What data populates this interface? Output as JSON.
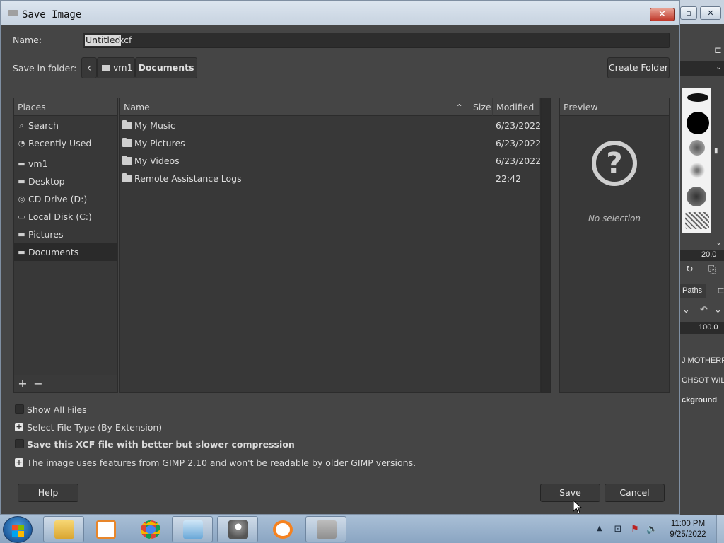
{
  "dialog": {
    "title": "Save Image",
    "close_label": "✕",
    "name_label": "Name:",
    "name_selected": "Untitled",
    "name_rest": ".xcf",
    "folder_label": "Save in folder:",
    "path": [
      "vm1",
      "Documents"
    ],
    "create_folder": "Create Folder"
  },
  "places": {
    "header": "Places",
    "items": [
      "Search",
      "Recently Used",
      "vm1",
      "Desktop",
      "CD Drive (D:)",
      "Local Disk (C:)",
      "Pictures",
      "Documents"
    ],
    "selected": "Documents",
    "add_label": "+",
    "remove_label": "−"
  },
  "files": {
    "columns": {
      "name": "Name",
      "size": "Size",
      "modified": "Modified"
    },
    "rows": [
      {
        "name": "My Music",
        "size": "",
        "modified": "6/23/2022"
      },
      {
        "name": "My Pictures",
        "size": "",
        "modified": "6/23/2022"
      },
      {
        "name": "My Videos",
        "size": "",
        "modified": "6/23/2022"
      },
      {
        "name": "Remote Assistance Logs",
        "size": "",
        "modified": "22:42"
      }
    ]
  },
  "preview": {
    "header": "Preview",
    "empty_text": "No selection"
  },
  "options": {
    "show_all_files": "Show All Files",
    "select_file_type": "Select File Type (By Extension)",
    "compression": "Save this XCF file with better but slower compression",
    "compat_note": "The image uses features from GIMP 2.10 and won't be readable by older GIMP versions."
  },
  "buttons": {
    "help": "Help",
    "save": "Save",
    "cancel": "Cancel"
  },
  "background_app": {
    "value1": "20.0",
    "tab_paths": "Paths",
    "value2": "100.0",
    "layer1": "J MOTHERFU",
    "layer2": "GHSOT WIL",
    "layer3": "ckground"
  },
  "taskbar": {
    "time": "11:00 PM",
    "date": "9/25/2022",
    "apps": [
      "explorer-icon",
      "media-player-icon",
      "chrome-icon",
      "control-panel-icon",
      "gimp-icon",
      "avast-icon",
      "thumbnail-icon"
    ]
  }
}
